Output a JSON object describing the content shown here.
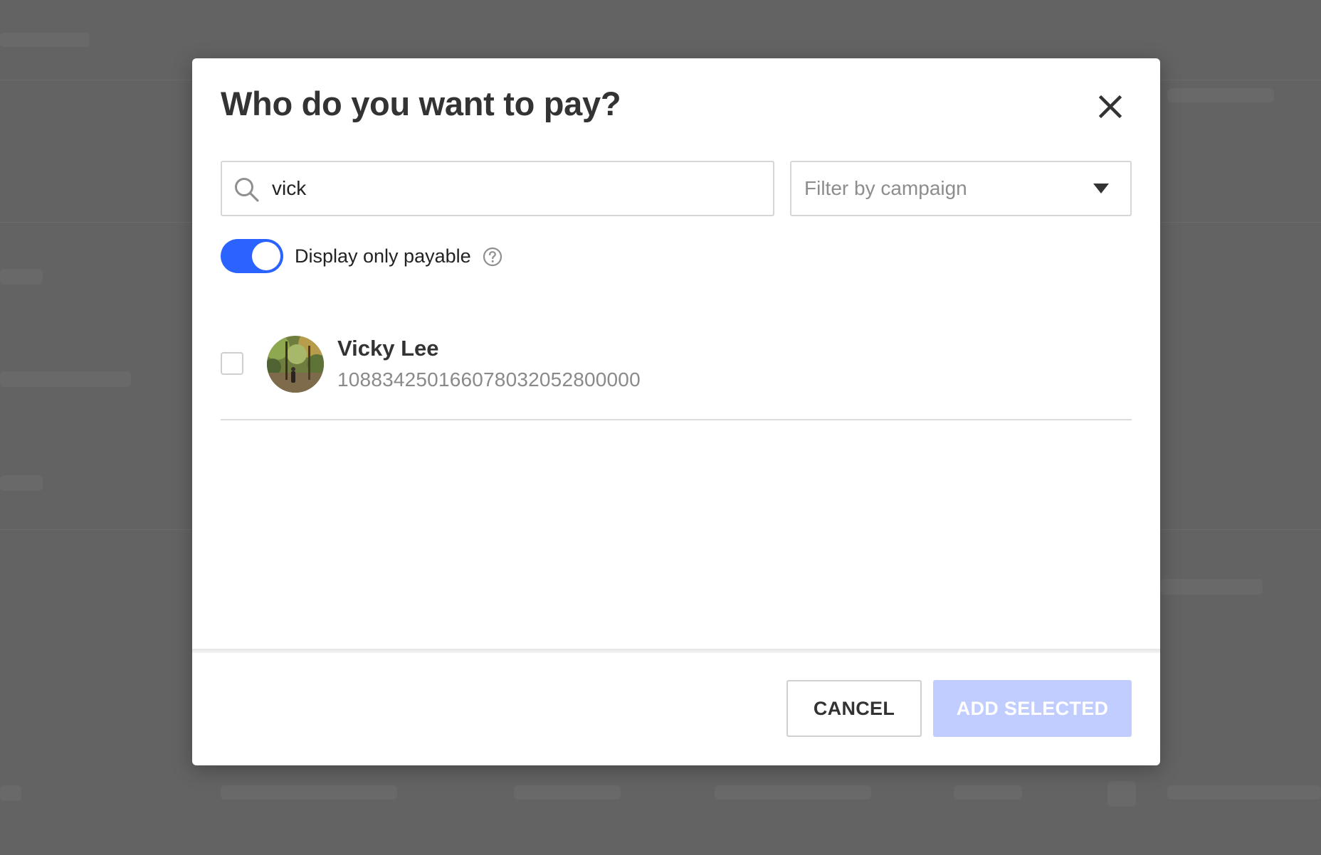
{
  "modal": {
    "title": "Who do you want to pay?"
  },
  "search": {
    "value": "vick"
  },
  "campaign_filter": {
    "placeholder": "Filter by campaign"
  },
  "payable_toggle": {
    "label": "Display only payable",
    "checked": true
  },
  "payees": [
    {
      "name": "Vicky Lee",
      "id": "108834250166078032052800000",
      "selected": false
    }
  ],
  "footer": {
    "cancel_label": "CANCEL",
    "add_label": "ADD SELECTED"
  },
  "colors": {
    "accent": "#2a63ff",
    "accent_disabled": "#c2cdff",
    "overlay": "#636363"
  }
}
